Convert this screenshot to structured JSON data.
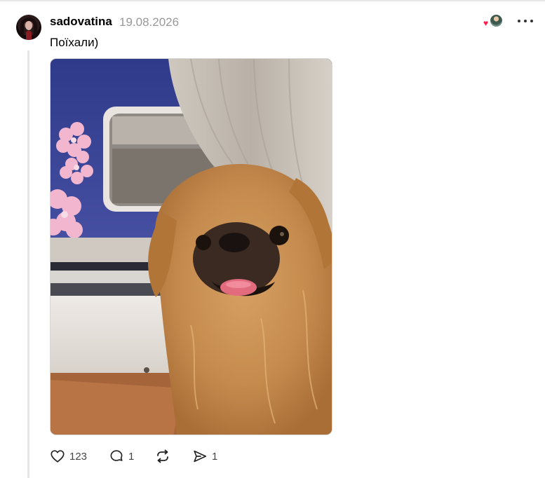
{
  "post": {
    "username": "sadovatina",
    "date": "19.08.2026",
    "text": "Поїхали)",
    "image_alt": "Pekingese dog on a train with window and curtain"
  },
  "reactors": {
    "heart_icon": "heart-icon"
  },
  "actions": {
    "like_count": "123",
    "comment_count": "1",
    "share_count": "1"
  },
  "colors": {
    "heart": "#ff1c4a",
    "date_gray": "#999999",
    "thread_line": "#e6e6e6"
  }
}
